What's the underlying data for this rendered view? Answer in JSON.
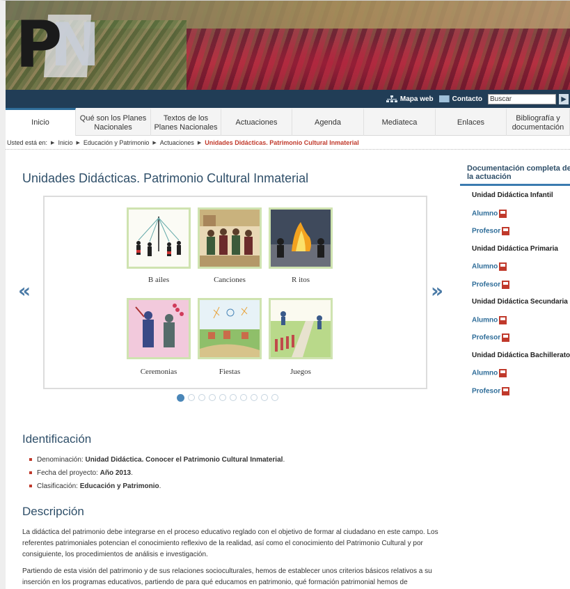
{
  "topbar": {
    "sitemap_label": "Mapa web",
    "contact_label": "Contacto",
    "search_placeholder": "Buscar"
  },
  "nav": {
    "tabs": [
      {
        "label": "Inicio"
      },
      {
        "label": "Qué son los Planes Nacionales"
      },
      {
        "label": "Textos de los Planes Nacionales"
      },
      {
        "label": "Actuaciones"
      },
      {
        "label": "Agenda"
      },
      {
        "label": "Mediateca"
      },
      {
        "label": "Enlaces"
      },
      {
        "label": "Bibliografía y documentación"
      }
    ]
  },
  "breadcrumb": {
    "prefix": "Usted está en:",
    "items": [
      "Inicio",
      "Educación y Patrimonio",
      "Actuaciones"
    ],
    "current": "Unidades Didácticas. Patrimonio Cultural Inmaterial"
  },
  "page_title": "Unidades Didácticas. Patrimonio Cultural Inmaterial",
  "carousel": {
    "items": [
      {
        "caption": "B ailes"
      },
      {
        "caption": "Canciones"
      },
      {
        "caption": "R itos"
      },
      {
        "caption": "Ceremonias"
      },
      {
        "caption": "Fiestas"
      },
      {
        "caption": "Juegos"
      }
    ],
    "prev_icon": "«",
    "next_icon": "»",
    "page_count": 10,
    "active_index": 0
  },
  "identification": {
    "heading": "Identificación",
    "rows": [
      {
        "label": "Denominación: ",
        "value": "Unidad Didáctica. Conocer el Patrimonio Cultural Inmaterial",
        "end": "."
      },
      {
        "label": "Fecha del proyecto: ",
        "value": "Año 2013",
        "end": "."
      },
      {
        "label": "Clasificación: ",
        "value": "Educación y Patrimonio",
        "end": "."
      }
    ]
  },
  "description": {
    "heading": "Descripción",
    "paragraphs": [
      "La didáctica del patrimonio debe integrarse en el proceso educativo reglado con el objetivo de formar al ciudadano en este campo. Los referentes patrimoniales potencian el conocimiento reflexivo de la realidad, así como el conocimiento del Patrimonio Cultural y por consiguiente, los procedimientos de análisis e investigación.",
      "Partiendo de esta visión del patrimonio y de sus relaciones socioculturales, hemos de establecer unos criterios básicos relativos a su inserción en los programas educativos, partiendo de para qué educamos en patrimonio, qué formación patrimonial hemos de"
    ]
  },
  "sidebar": {
    "title": "Documentación completa de la actuación",
    "groups": [
      {
        "heading": "Unidad Didáctica Infantil",
        "links": [
          "Alumno",
          "Profesor"
        ]
      },
      {
        "heading": "Unidad Didáctica Primaria",
        "links": [
          "Alumno",
          "Profesor"
        ]
      },
      {
        "heading": "Unidad Didáctica Secundaria",
        "links": [
          "Alumno",
          "Profesor"
        ]
      },
      {
        "heading": "Unidad Didáctica Bachillerato",
        "links": [
          "Alumno",
          "Profesor"
        ]
      }
    ]
  },
  "colors": {
    "topbar": "#213d56",
    "accent": "#2f6d99",
    "breadcrumb_current": "#c0392b",
    "heading": "#2f4f69"
  }
}
